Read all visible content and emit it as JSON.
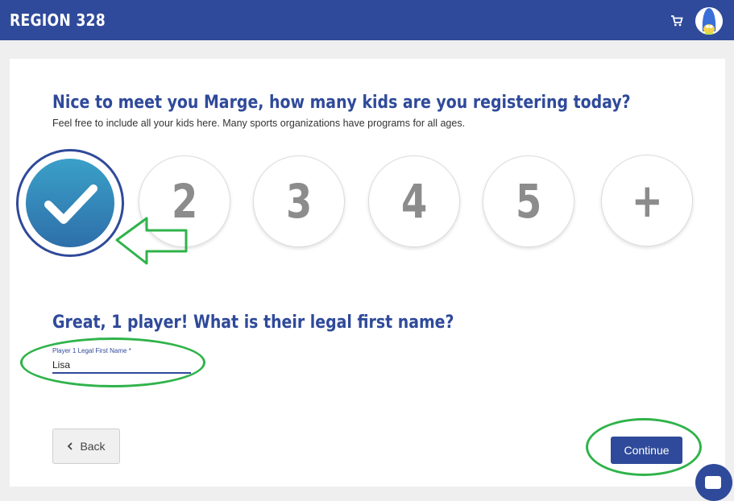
{
  "header": {
    "brand": "REGION 328",
    "cart_icon": "shopping-cart-icon",
    "avatar_icon": "marge-avatar-icon"
  },
  "main": {
    "question_kids": "Nice to meet you Marge, how many kids are you registering today?",
    "subtitle": "Feel free to include all your kids here. Many sports organizations have programs for all ages.",
    "kid_options": [
      {
        "label": "",
        "icon": "checkmark-icon",
        "selected": true
      },
      {
        "label": "2",
        "selected": false
      },
      {
        "label": "3",
        "selected": false
      },
      {
        "label": "4",
        "selected": false
      },
      {
        "label": "5",
        "selected": false
      },
      {
        "label": "+",
        "selected": false
      }
    ],
    "question_name": "Great, 1 player! What is their legal first name?",
    "first_name_label": "Player 1 Legal First Name *",
    "first_name_value": "Lisa"
  },
  "actions": {
    "back_icon": "chevron-left-icon",
    "back_label": "Back",
    "continue_label": "Continue"
  },
  "chat": {
    "icon": "chat-icon"
  },
  "colors": {
    "brand": "#2f4a9a",
    "annotation": "#2fb34a"
  }
}
